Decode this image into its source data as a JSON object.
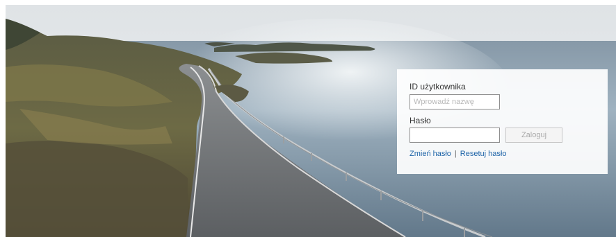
{
  "login": {
    "user_id_label": "ID użytkownika",
    "user_id_placeholder": "Wprowadź nazwę",
    "user_id_value": "",
    "password_label": "Hasło",
    "password_value": "",
    "login_button": "Zaloguj",
    "change_password_link": "Zmień hasło",
    "separator": "|",
    "reset_password_link": "Resetuj hasło"
  },
  "colors": {
    "link": "#1e64a8",
    "panel_bg": "#ffffff",
    "button_text_disabled": "#a9a9a9"
  }
}
